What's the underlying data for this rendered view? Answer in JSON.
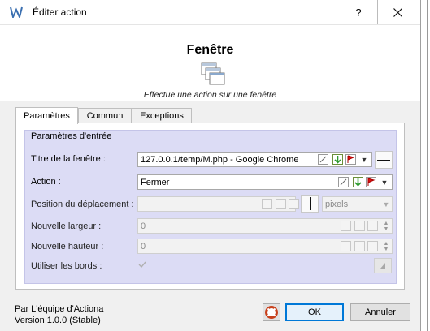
{
  "window": {
    "title": "Éditer action",
    "help_label": "?",
    "close_label": "✕"
  },
  "header": {
    "title": "Fenêtre",
    "description": "Effectue une action sur une fenêtre"
  },
  "tabs": [
    {
      "label": "Paramètres"
    },
    {
      "label": "Commun"
    },
    {
      "label": "Exceptions"
    }
  ],
  "group": {
    "title": "Paramètres d'entrée"
  },
  "fields": {
    "window_title": {
      "label": "Titre de la fenêtre :",
      "value": "127.0.0.1/temp/M.php - Google Chrome"
    },
    "action": {
      "label": "Action :",
      "value": "Fermer"
    },
    "move_position": {
      "label": "Position du déplacement :",
      "value": "",
      "unit": "pixels"
    },
    "new_width": {
      "label": "Nouvelle largeur :",
      "value": "0"
    },
    "new_height": {
      "label": "Nouvelle hauteur :",
      "value": "0"
    },
    "use_borders": {
      "label": "Utiliser les bords :",
      "checked": true
    }
  },
  "footer": {
    "credits_line1": "Par L'équipe d'Actiona",
    "credits_line2": "Version 1.0.0 (Stable)",
    "ok_label": "OK",
    "cancel_label": "Annuler"
  },
  "colors": {
    "group_bg": "#dcdcf5",
    "accent": "#0078d7"
  }
}
